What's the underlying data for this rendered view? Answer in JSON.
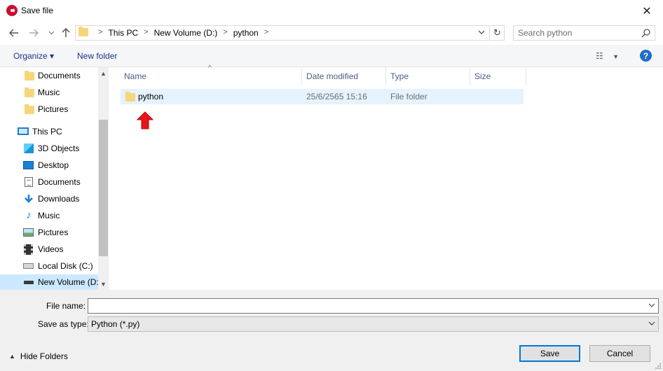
{
  "window": {
    "title": "Save file",
    "close_label": "✕"
  },
  "address": {
    "crumbs": [
      "This PC",
      "New Volume (D:)",
      "python"
    ]
  },
  "search": {
    "placeholder": "Search python"
  },
  "toolbar": {
    "organize_label": "Organize ▾",
    "new_folder_label": "New folder",
    "help_label": "?"
  },
  "sidebar": {
    "items": [
      {
        "label": "Documents",
        "icon": "folder-icon"
      },
      {
        "label": "Music",
        "icon": "folder-icon"
      },
      {
        "label": "Pictures",
        "icon": "folder-icon"
      },
      {
        "label": "This PC",
        "icon": "computer-icon"
      },
      {
        "label": "3D Objects",
        "icon": "cube-icon"
      },
      {
        "label": "Desktop",
        "icon": "desktop-icon"
      },
      {
        "label": "Documents",
        "icon": "document-icon"
      },
      {
        "label": "Downloads",
        "icon": "download-icon"
      },
      {
        "label": "Music",
        "icon": "music-icon"
      },
      {
        "label": "Pictures",
        "icon": "picture-icon"
      },
      {
        "label": "Videos",
        "icon": "video-icon"
      },
      {
        "label": "Local Disk (C:)",
        "icon": "drive-icon"
      },
      {
        "label": "New Volume (D:)",
        "icon": "drive-icon",
        "selected": true
      }
    ]
  },
  "filelist": {
    "columns": [
      "Name",
      "Date modified",
      "Type",
      "Size"
    ],
    "rows": [
      {
        "name": "python",
        "date": "25/6/2565 15:16",
        "type": "File folder",
        "size": ""
      }
    ]
  },
  "bottom": {
    "filename_label": "File name:",
    "filename_value": "",
    "savetype_label": "Save as type:",
    "savetype_value": "Python (*.py)",
    "hide_folders_label": "Hide Folders",
    "save_label": "Save",
    "cancel_label": "Cancel"
  },
  "colors": {
    "accent": "#0078d7",
    "selection": "#cce8ff",
    "row_highlight": "#e5f3ff",
    "annotation_arrow": "#e8141c"
  }
}
